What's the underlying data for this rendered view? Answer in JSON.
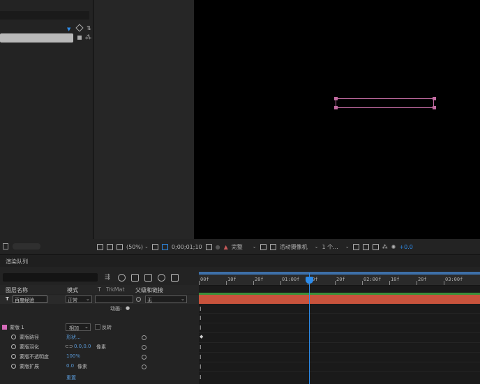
{
  "comp_toolbar": {
    "zoom": "(50%)",
    "timecode": "0;00;01;10",
    "resolution": "完整",
    "camera": "活动摄像机",
    "views": "1 个...",
    "exposure": "+0.0"
  },
  "render_queue_tab": "渲染队列",
  "timeline": {
    "ruler_labels": [
      "00f",
      "10f",
      "20f",
      "01:00f",
      "10f",
      "20f",
      "02:00f",
      "10f",
      "20f",
      "03:00f"
    ],
    "columns": {
      "layer_name": "图层名称",
      "mode": "模式",
      "t": "T",
      "trkmat": "TrkMat",
      "parent": "父级和链接"
    },
    "layer": {
      "type_icon": "T",
      "name": "百度经验",
      "mode": "正常",
      "parent": "无",
      "animate": "动画:",
      "reverse": "反转"
    },
    "sub_rows": [
      {
        "name": "蒙版 1",
        "mode": "相加"
      },
      {
        "name": "蒙版路径",
        "value": "形状..."
      },
      {
        "name": "蒙版羽化",
        "value": "0.0,0.0",
        "unit": "像素"
      },
      {
        "name": "蒙版不透明度",
        "value": "100%"
      },
      {
        "name": "蒙版扩展",
        "value": "0.0",
        "unit": "像素"
      }
    ],
    "reset": "重置"
  },
  "colors": {
    "accent_blue": "#2d8ceb",
    "layer_bar": "#c8533c",
    "mask_color": "#d46ab8",
    "shape_outline": "#c06aa0"
  }
}
